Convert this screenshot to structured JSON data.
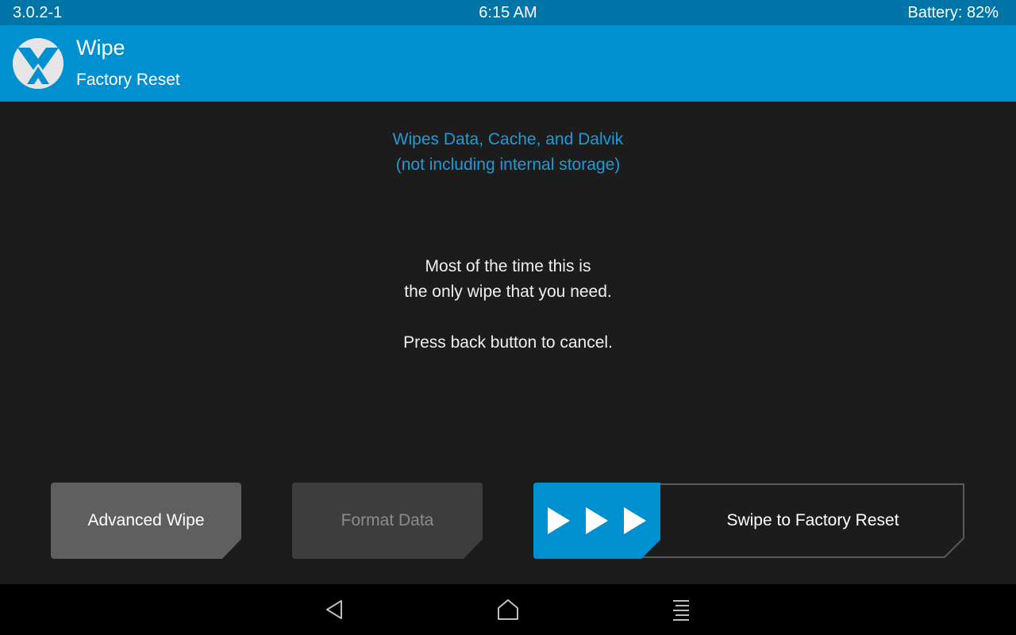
{
  "status_bar": {
    "version": "3.0.2-1",
    "time": "6:15 AM",
    "battery": "Battery: 82%"
  },
  "header": {
    "logo_icon": "twrp-logo-icon",
    "title": "Wipe",
    "subtitle": "Factory Reset"
  },
  "main": {
    "info_line1": "Wipes Data, Cache, and Dalvik",
    "info_line2": "(not including internal storage)",
    "message_line1": "Most of the time this is",
    "message_line2": "the only wipe that you need.",
    "message_line3": "Press back button to cancel."
  },
  "buttons": {
    "advanced_wipe": "Advanced Wipe",
    "format_data": "Format Data"
  },
  "swipe": {
    "label": "Swipe to Factory Reset",
    "handle_icon": "triple-arrow-right-icon"
  },
  "navbar": {
    "back_icon": "back-triangle-icon",
    "home_icon": "home-icon",
    "menu_icon": "menu-lines-icon"
  },
  "colors": {
    "accent": "#0090cf",
    "status_bar": "#0075a8",
    "background": "#1c1c1c",
    "info_text": "#1f9bd8",
    "button_primary": "#5f5f5f",
    "button_disabled": "#3d3d3d"
  }
}
